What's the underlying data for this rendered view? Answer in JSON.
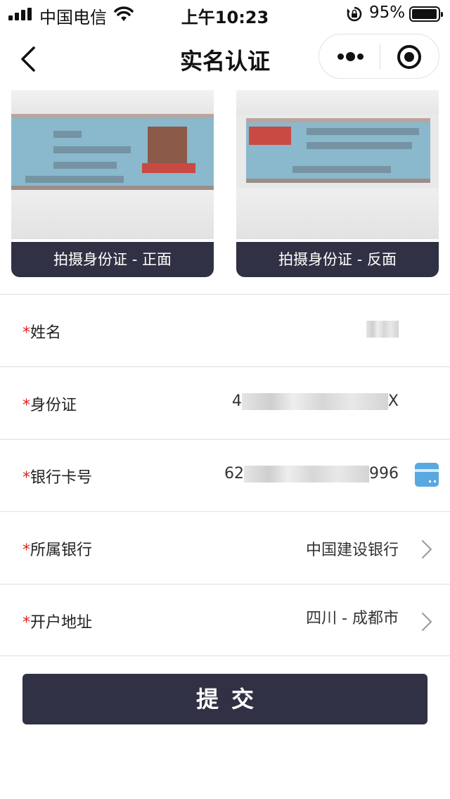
{
  "status_bar": {
    "carrier": "中国电信",
    "time": "上午10:23",
    "battery_percent": "95%",
    "battery_level": 0.95,
    "icons": [
      "signal-icon",
      "wifi-icon",
      "rotation-lock-icon",
      "battery-icon"
    ]
  },
  "nav": {
    "title": "实名认证",
    "back_icon": "chevron-left-icon",
    "more_icon": "more-dots-icon",
    "close_icon": "target-close-icon"
  },
  "id_cards": {
    "front_caption": "拍摄身份证 - 正面",
    "back_caption": "拍摄身份证 - 反面"
  },
  "form": {
    "required_mark": "*",
    "name": {
      "label": "姓名",
      "value": ""
    },
    "id_number": {
      "label": "身份证",
      "value_prefix": "4",
      "value_suffix": "X"
    },
    "bank_card": {
      "label": "银行卡号",
      "value_prefix": "62",
      "value_suffix": "996",
      "icon": "bank-card-icon"
    },
    "bank": {
      "label": "所属银行",
      "value": "中国建设银行"
    },
    "address": {
      "label": "开户地址",
      "value": "四川 - 成都市"
    }
  },
  "submit": {
    "label": "提交"
  },
  "colors": {
    "primary_dark": "#313145",
    "required_red": "#e02020",
    "card_icon_blue": "#5aa8e0",
    "divider": "#dedede"
  }
}
